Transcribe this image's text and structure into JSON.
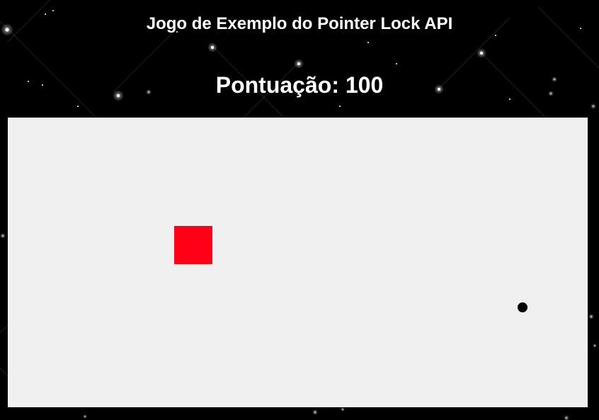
{
  "header": {
    "title": "Jogo de Exemplo do Pointer Lock API",
    "score_text": "Pontuação: 100"
  },
  "game": {
    "score": 100,
    "target_shape": "square",
    "pointer_shape": "dot",
    "colors": {
      "page_background": "#000000",
      "canvas_background": "#f0f0f0",
      "target": "#ff0016",
      "pointer": "#000000",
      "text": "#ffffff"
    }
  },
  "background": {
    "style": "starfield"
  }
}
